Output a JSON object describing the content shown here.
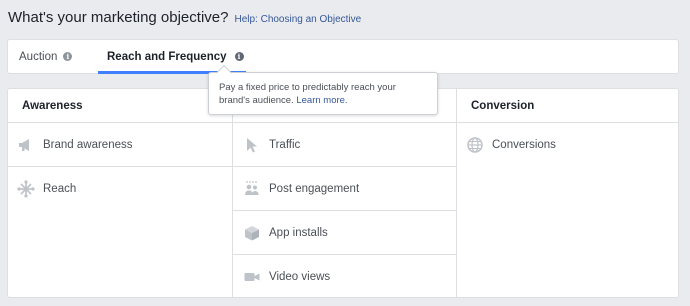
{
  "header": {
    "title": "What's your marketing objective?",
    "help_link": "Help: Choosing an Objective"
  },
  "tabs": [
    {
      "label": "Auction",
      "selected": false
    },
    {
      "label": "Reach and Frequency",
      "selected": true
    }
  ],
  "tooltip": {
    "text": "Pay a fixed price to predictably reach your brand's audience.",
    "link": "Learn more."
  },
  "columns": [
    {
      "heading": "Awareness",
      "items": [
        {
          "label": "Brand awareness",
          "icon": "megaphone-icon"
        },
        {
          "label": "Reach",
          "icon": "reach-icon"
        }
      ]
    },
    {
      "heading": "",
      "items": [
        {
          "label": "Traffic",
          "icon": "cursor-icon"
        },
        {
          "label": "Post engagement",
          "icon": "people-icon"
        },
        {
          "label": "App installs",
          "icon": "box-icon"
        },
        {
          "label": "Video views",
          "icon": "video-camera-icon"
        }
      ]
    },
    {
      "heading": "Conversion",
      "items": [
        {
          "label": "Conversions",
          "icon": "globe-icon"
        }
      ]
    }
  ],
  "colors": {
    "accent": "#4080ff",
    "link": "#365899",
    "background": "#e9ebee",
    "icon": "#bec2c9"
  }
}
